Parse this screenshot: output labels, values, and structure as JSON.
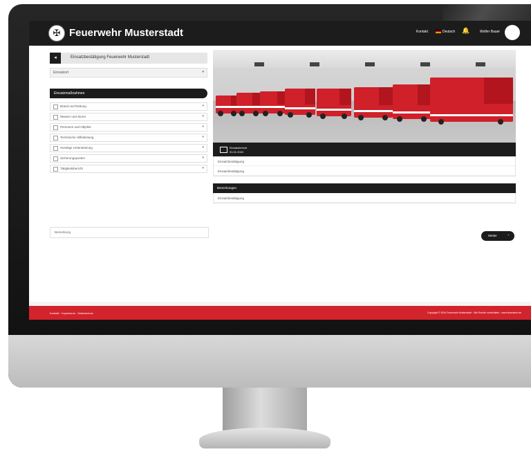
{
  "header": {
    "brand": "Feuerwehr Musterstadt",
    "nav_items": [
      "Kontakt",
      "Deutsch",
      "Wolfer Bauer"
    ],
    "colors": {
      "header_bg": "#1c1c1c",
      "accent": "#d3232c"
    }
  },
  "sidebar": {
    "title": "Einsatzbestätigung Feuerwehr Musterstadt",
    "select_value": "Einsatzort",
    "section_title": "Einsatzmaßnahmen",
    "items": [
      "Brand und Rettung",
      "Wasser und Sturm",
      "Personen und Objekte",
      "Technische Hilfeleistung",
      "Sonstige Unterstützung",
      "Sicherungsposten",
      "Tätigkeitsbericht"
    ]
  },
  "photo": {
    "caption_line1": "Einsatzbericht",
    "caption_line2": "01.01.2024"
  },
  "main": {
    "rows": [
      "Einsatzbestätigung",
      "Einsatzbestätigung"
    ],
    "block2_title": "Bemerkungen",
    "block2_row": "Einsatzbestätigung",
    "search_placeholder": "Bemerkung",
    "next_button": "Weiter"
  },
  "footer": {
    "links": "Kontakt · Impressum · Datenschutz",
    "copyright": "Copyright © 2024 Feuerwehr Musterstadt · Alle Rechte vorbehalten · www.feuerwehr.de"
  }
}
